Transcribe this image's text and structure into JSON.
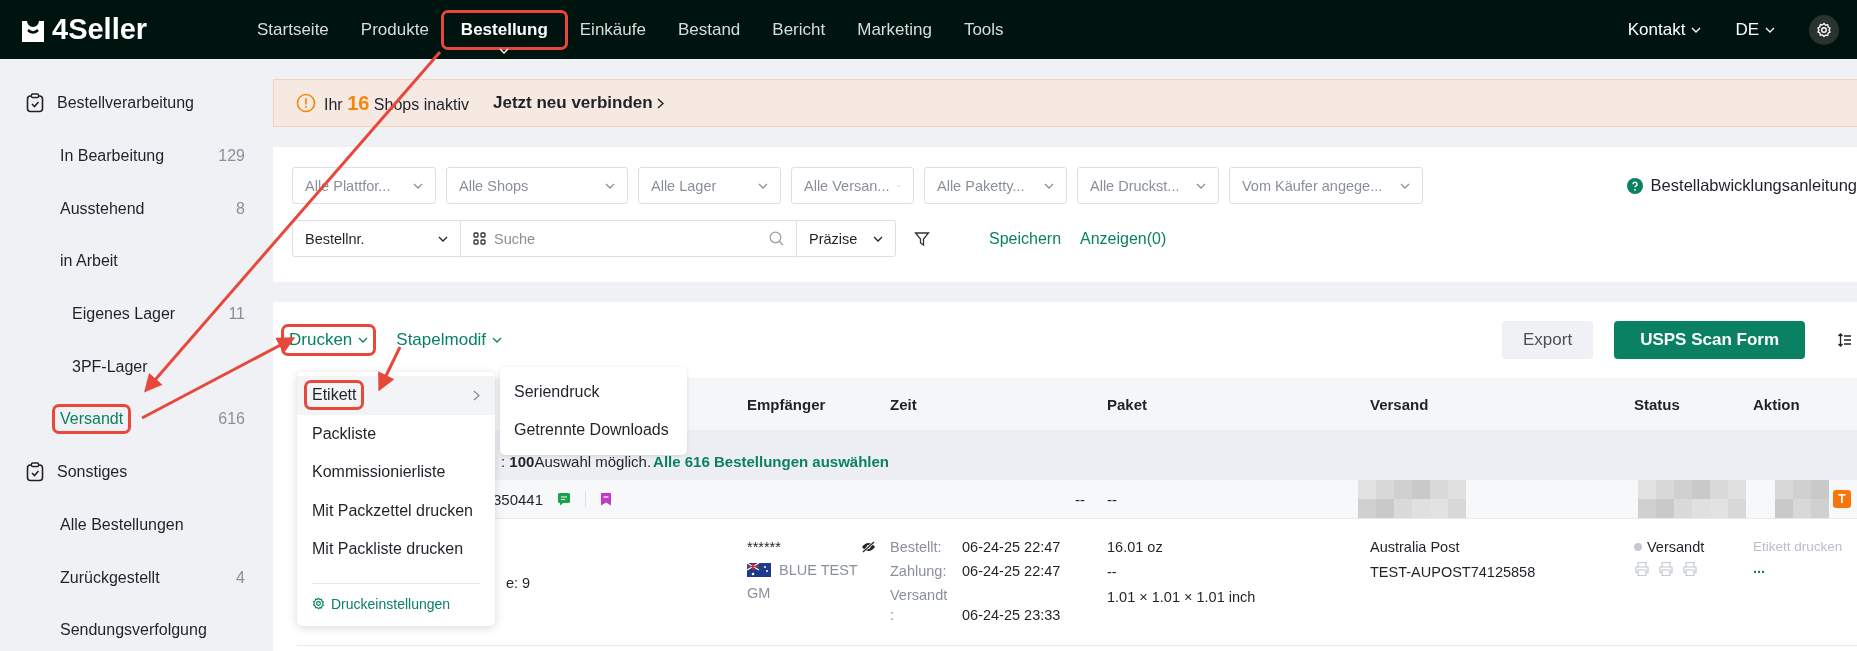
{
  "logo": {
    "text": "4Seller"
  },
  "nav": [
    {
      "label": "Startseite",
      "selected": false,
      "annotated": false
    },
    {
      "label": "Produkte",
      "selected": false,
      "annotated": false
    },
    {
      "label": "Bestellung",
      "selected": true,
      "annotated": true
    },
    {
      "label": "Einkäufe",
      "selected": false,
      "annotated": false
    },
    {
      "label": "Bestand",
      "selected": false,
      "annotated": false
    },
    {
      "label": "Bericht",
      "selected": false,
      "annotated": false
    },
    {
      "label": "Marketing",
      "selected": false,
      "annotated": false
    },
    {
      "label": "Tools",
      "selected": false,
      "annotated": false
    }
  ],
  "header_right": {
    "contact": "Kontakt",
    "language": "DE"
  },
  "sidebar": {
    "groups": [
      {
        "label": "Bestellverarbeitung",
        "items": [
          {
            "label": "In Bearbeitung",
            "count": "129",
            "selected": false,
            "annotated": false
          },
          {
            "label": "Ausstehend",
            "count": "8",
            "selected": false,
            "annotated": false
          },
          {
            "label": "in Arbeit",
            "selected": false,
            "annotated": false,
            "children": [
              {
                "label": "Eigenes Lager",
                "count": "11",
                "selected": false,
                "annotated": false
              },
              {
                "label": "3PF-Lager",
                "selected": false,
                "annotated": false
              }
            ]
          },
          {
            "label": "Versandt",
            "count": "616",
            "selected": true,
            "annotated": true
          }
        ]
      },
      {
        "label": "Sonstiges",
        "items": [
          {
            "label": "Alle Bestellungen",
            "selected": false,
            "annotated": false
          },
          {
            "label": "Zurückgestellt",
            "count": "4",
            "selected": false,
            "annotated": false
          },
          {
            "label": "Sendungsverfolgung",
            "selected": false,
            "annotated": false
          }
        ]
      }
    ]
  },
  "banner": {
    "prefix": "Ihr",
    "count": "16",
    "suffix": "Shops inaktiv",
    "link": "Jetzt neu verbinden"
  },
  "filters": {
    "selects": [
      "Alle Plattfor...",
      "Alle Shops",
      "Alle Lager",
      "Alle Versan...",
      "Alle Paketty...",
      "Alle Druckst...",
      "Vom Käufer angege..."
    ],
    "help": "Bestellabwicklungsanleitung",
    "search": {
      "field_select": "Bestellnr.",
      "placeholder": "Suche",
      "mode": "Präzise"
    },
    "save": "Speichern",
    "show": "Anzeigen(0)"
  },
  "toolbar": {
    "print": {
      "label": "Drucken",
      "annotated": true
    },
    "batch": "Stapelmodif",
    "export": "Export",
    "scan_form": "USPS Scan Form"
  },
  "print_menu": {
    "items": [
      {
        "label": "Etikett",
        "selected": true,
        "annotated": true,
        "submenu": true
      },
      {
        "label": "Packliste",
        "selected": false,
        "annotated": false,
        "submenu": false
      },
      {
        "label": "Kommissionierliste",
        "selected": false,
        "annotated": false,
        "submenu": false
      },
      {
        "label": "Mit Packzettel drucken",
        "selected": false,
        "annotated": false,
        "submenu": false
      },
      {
        "label": "Mit Packliste drucken",
        "selected": false,
        "annotated": false,
        "submenu": false
      }
    ],
    "settings": "Druckeinstellungen"
  },
  "submenu": {
    "items": [
      "Seriendruck",
      "Getrennte Downloads"
    ]
  },
  "table": {
    "columns": [
      "Empfänger",
      "Zeit",
      "Paket",
      "Versand",
      "Status",
      "Aktion"
    ],
    "selection_note": {
      "text": ": **100**Auswahl möglich.",
      "link": "Alle 616 Bestellungen auswählen"
    },
    "order": {
      "number": "350441",
      "time": "--",
      "package": "--",
      "badge": "T"
    },
    "detail": {
      "partial": "e: 9",
      "recipient": {
        "name": "******",
        "label": "BLUE TEST",
        "sub": "GM"
      },
      "times": [
        {
          "label": "Bestellt:",
          "value": "06-24-25 22:47"
        },
        {
          "label": "Zahlung:",
          "value": "06-24-25 22:47"
        },
        {
          "label": "Versandt",
          "label2": ":",
          "value": "06-24-25 23:33"
        }
      ],
      "package": [
        "16.01 oz",
        "--",
        "1.01 × 1.01 × 1.01 inch"
      ],
      "shipping": [
        "Australia Post",
        "TEST-AUPOST74125858"
      ],
      "status": "Versandt",
      "action": {
        "label": "Etikett drucken",
        "disabled": true,
        "more": "..."
      }
    }
  }
}
